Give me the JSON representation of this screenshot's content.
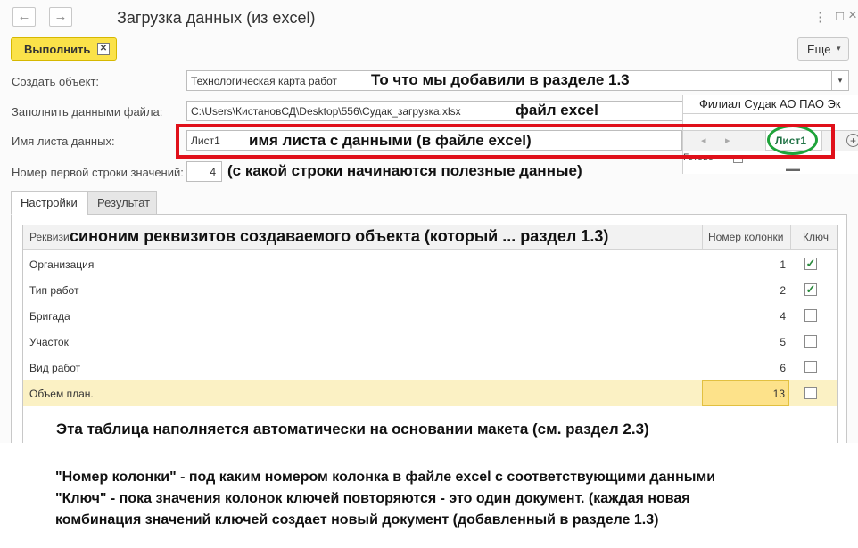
{
  "window": {
    "title": "Загрузка данных (из excel)",
    "back_icon": "←",
    "forward_icon": "→",
    "menu_icon": "⋮",
    "restore_icon": "□",
    "close_icon": "×"
  },
  "toolbar": {
    "run_label": "Выполнить",
    "more_label": "Еще",
    "more_chevron": "▾"
  },
  "form": {
    "create_object_label": "Создать объект:",
    "create_object_value": "Технологическая карта работ",
    "fill_file_label": "Заполнить данными файла:",
    "fill_file_value": "C:\\Users\\КистановСД\\Desktop\\556\\Судак_загрузка.xlsx",
    "sheet_name_label": "Имя листа данных:",
    "sheet_name_value": "Лист1",
    "first_row_label": "Номер первой строки значений:",
    "first_row_value": "4"
  },
  "annotations": {
    "object_note": "То что мы добавили в разделе 1.3",
    "file_note": "файл excel",
    "sheet_note": "имя листа с данными (в файле excel)",
    "first_row_note": "(с какой строки начинаются полезные данные)",
    "attr_note": "синоним реквизитов создаваемого объекта (который ... раздел 1.3)",
    "table_note": "Эта таблица наполняется автоматически на основании макета (см. раздел 2.3)",
    "footer_line1": "\"Номер колонки\" - под каким номером колонка в файле excel с соответствующими данными",
    "footer_line2": "\"Ключ\" - пока значения колонок ключей повторяются - это один документ. (каждая новая",
    "footer_line3": "комбинация значений ключей создает новый документ (добавленный в разделе 1.3)"
  },
  "excel": {
    "header_text": "Филиал  Судак  АО  ПАО  Эк",
    "sheet_tab": "Лист1",
    "status": "Готово"
  },
  "tabs": {
    "settings": "Настройки",
    "result": "Результат"
  },
  "table": {
    "col_attr": "Реквизит",
    "col_num": "Номер колонки",
    "col_key": "Ключ",
    "rows": [
      {
        "name": "Организация",
        "num": "1",
        "key": true
      },
      {
        "name": "Тип работ",
        "num": "2",
        "key": true
      },
      {
        "name": "Бригада",
        "num": "4",
        "key": false
      },
      {
        "name": "Участок",
        "num": "5",
        "key": false
      },
      {
        "name": "Вид работ",
        "num": "6",
        "key": false
      },
      {
        "name": "Объем план.",
        "num": "13",
        "key": false
      }
    ]
  },
  "colors": {
    "accent_yellow": "#fbe249",
    "highlight_red": "#e0101a",
    "oval_green": "#1ea33a",
    "selected_row": "#fbf1c4"
  }
}
